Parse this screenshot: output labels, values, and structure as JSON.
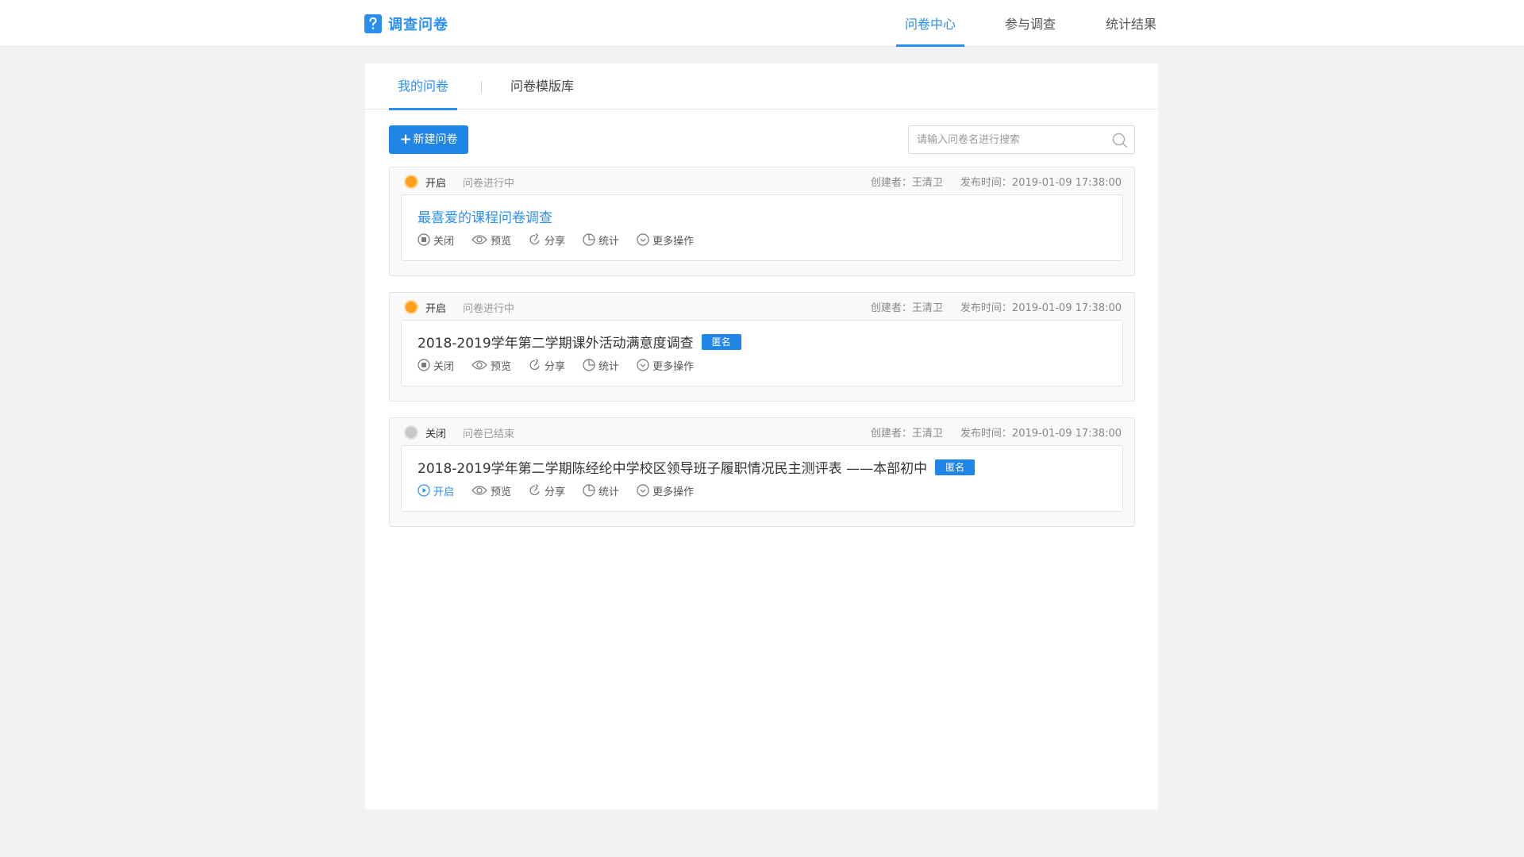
{
  "app": {
    "title": "调查问卷"
  },
  "nav": [
    {
      "label": "问卷中心",
      "active": true
    },
    {
      "label": "参与调查",
      "active": false
    },
    {
      "label": "统计结果",
      "active": false
    }
  ],
  "tabs": [
    {
      "label": "我的问卷",
      "active": true
    },
    {
      "label": "问卷模版库",
      "active": false
    }
  ],
  "toolbar": {
    "new_button": "新建问卷",
    "search_placeholder": "请输入问卷名进行搜索"
  },
  "colors": {
    "accent": "#2a8ff0",
    "status_on": "#ff9f1a",
    "status_off": "#c8c8c8"
  },
  "surveys": [
    {
      "status": "开启",
      "status_desc": "问卷进行中",
      "creator": "创建者：王清卫",
      "published": "发布时间：2019-01-09   17:38:00",
      "title": "最喜爱的课程问卷调查",
      "anonymous": "",
      "actions": {
        "toggle": "关闭",
        "preview": "预览",
        "share": "分享",
        "stats": "统计",
        "more": "更多操作"
      }
    },
    {
      "status": "开启",
      "status_desc": "问卷进行中",
      "creator": "创建者：王清卫",
      "published": "发布时间：2019-01-09   17:38:00",
      "title": "2018-2019学年第二学期课外活动满意度调查",
      "anonymous": "匿名",
      "actions": {
        "toggle": "关闭",
        "preview": "预览",
        "share": "分享",
        "stats": "统计",
        "more": "更多操作"
      }
    },
    {
      "status": "关闭",
      "status_desc": "问卷已结束",
      "creator": "创建者：王清卫",
      "published": "发布时间：2019-01-09   17:38:00",
      "title": "2018-2019学年第二学期陈经纶中学校区领导班子履职情况民主测评表 ——本部初中",
      "anonymous": "匿名",
      "actions": {
        "toggle": "开启",
        "preview": "预览",
        "share": "分享",
        "stats": "统计",
        "more": "更多操作"
      }
    }
  ]
}
